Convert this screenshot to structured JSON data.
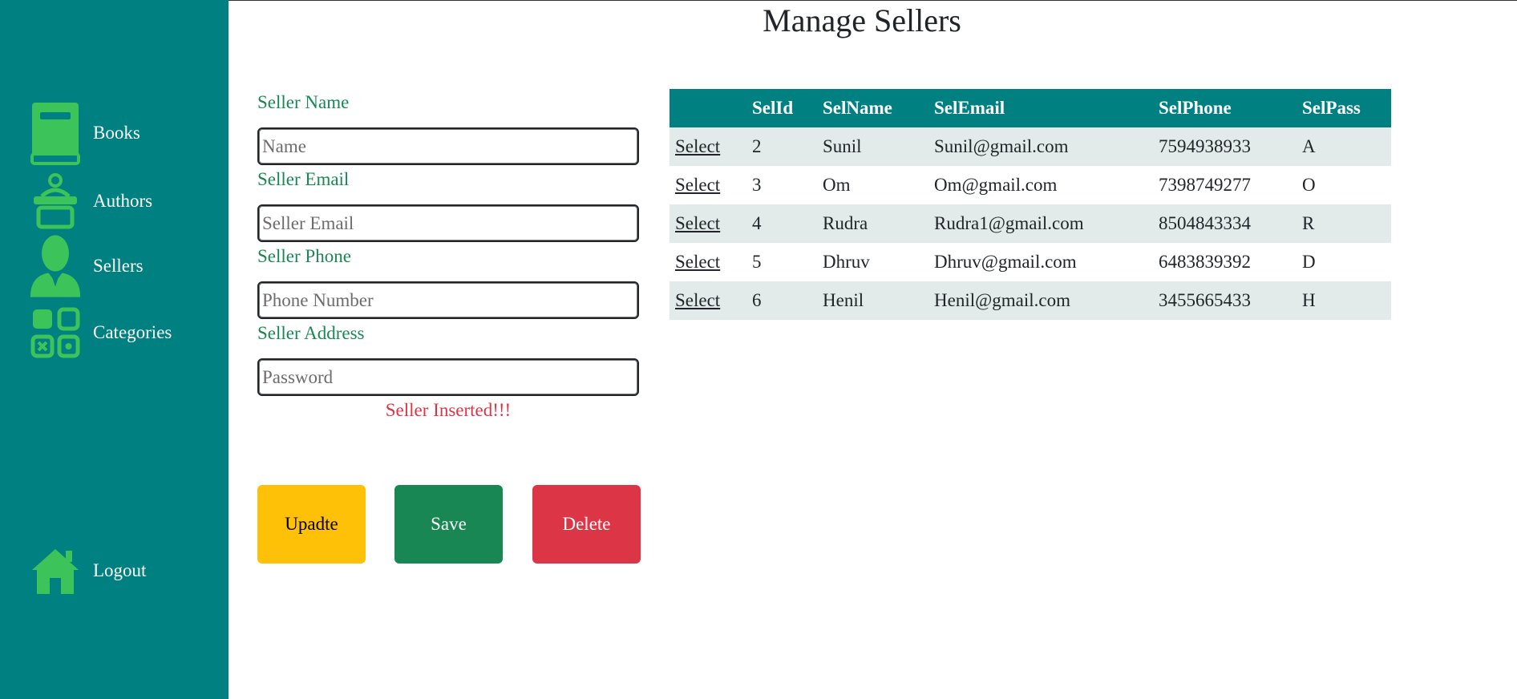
{
  "page": {
    "title": "Manage Sellers"
  },
  "sidebar": {
    "items": [
      {
        "label": "Books",
        "icon": "book-icon"
      },
      {
        "label": "Authors",
        "icon": "author-icon"
      },
      {
        "label": "Sellers",
        "icon": "seller-icon"
      },
      {
        "label": "Categories",
        "icon": "categories-icon"
      }
    ],
    "logout": {
      "label": "Logout",
      "icon": "home-icon"
    }
  },
  "form": {
    "name_label": "Seller Name",
    "name_placeholder": "Name",
    "name_value": "",
    "email_label": "Seller Email",
    "email_placeholder": "Seller Email",
    "email_value": "",
    "phone_label": "Seller Phone",
    "phone_placeholder": "Phone Number",
    "phone_value": "",
    "address_label": "Seller Address",
    "address_placeholder": "Password",
    "address_value": "",
    "message": "Seller Inserted!!!"
  },
  "buttons": {
    "update_label": "Upadte",
    "save_label": "Save",
    "delete_label": "Delete"
  },
  "table": {
    "headers": [
      "",
      "SelId",
      "SelName",
      "SelEmail",
      "SelPhone",
      "SelPass"
    ],
    "rows": [
      {
        "action": "Select",
        "id": "2",
        "name": "Sunil",
        "email": "Sunil@gmail.com",
        "phone": "7594938933",
        "pass": "A"
      },
      {
        "action": "Select",
        "id": "3",
        "name": "Om",
        "email": "Om@gmail.com",
        "phone": "7398749277",
        "pass": "O"
      },
      {
        "action": "Select",
        "id": "4",
        "name": "Rudra",
        "email": "Rudra1@gmail.com",
        "phone": "8504843334",
        "pass": "R"
      },
      {
        "action": "Select",
        "id": "5",
        "name": "Dhruv",
        "email": "Dhruv@gmail.com",
        "phone": "6483839392",
        "pass": "D"
      },
      {
        "action": "Select",
        "id": "6",
        "name": "Henil",
        "email": "Henil@gmail.com",
        "phone": "3455665433",
        "pass": "H"
      }
    ]
  },
  "colors": {
    "sidebar": "#008080",
    "icon": "#3cc35a",
    "label": "#198754",
    "message": "#dc3545",
    "update": "#ffc107",
    "save": "#198754",
    "delete": "#dc3545"
  }
}
